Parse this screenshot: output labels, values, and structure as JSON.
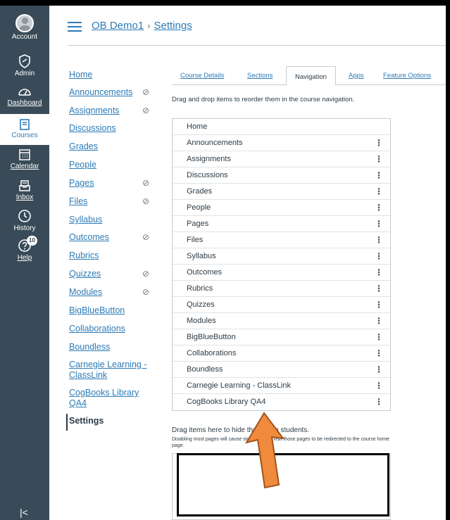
{
  "global_nav": [
    {
      "label": "Account",
      "icon": "avatar"
    },
    {
      "label": "Admin",
      "icon": "shield-icon"
    },
    {
      "label": "Dashboard",
      "icon": "dashboard-icon"
    },
    {
      "label": "Courses",
      "icon": "book-icon"
    },
    {
      "label": "Calendar",
      "icon": "calendar-icon"
    },
    {
      "label": "Inbox",
      "icon": "inbox-icon"
    },
    {
      "label": "History",
      "icon": "clock-icon"
    },
    {
      "label": "Help",
      "icon": "help-icon",
      "badge": "10"
    }
  ],
  "header": {
    "course": "OB Demo1",
    "separator": "›",
    "page": "Settings"
  },
  "course_nav": [
    {
      "label": "Home"
    },
    {
      "label": "Announcements",
      "hidden": true
    },
    {
      "label": "Assignments",
      "hidden": true
    },
    {
      "label": "Discussions"
    },
    {
      "label": "Grades"
    },
    {
      "label": "People"
    },
    {
      "label": "Pages",
      "hidden": true
    },
    {
      "label": "Files",
      "hidden": true
    },
    {
      "label": "Syllabus"
    },
    {
      "label": "Outcomes",
      "hidden": true
    },
    {
      "label": "Rubrics"
    },
    {
      "label": "Quizzes",
      "hidden": true
    },
    {
      "label": "Modules",
      "hidden": true
    },
    {
      "label": "BigBlueButton"
    },
    {
      "label": "Collaborations"
    },
    {
      "label": "Boundless"
    },
    {
      "label": "Carnegie Learning - ClassLink"
    },
    {
      "label": "CogBooks Library QA4"
    },
    {
      "label": "Settings",
      "active": true
    }
  ],
  "tabs": [
    {
      "label": "Course Details"
    },
    {
      "label": "Sections"
    },
    {
      "label": "Navigation",
      "selected": true
    },
    {
      "label": "Apps"
    },
    {
      "label": "Feature Options"
    }
  ],
  "instructions": "Drag and drop items to reorder them in the course navigation.",
  "nav_items": [
    "Home",
    "Announcements",
    "Assignments",
    "Discussions",
    "Grades",
    "People",
    "Pages",
    "Files",
    "Syllabus",
    "Outcomes",
    "Rubrics",
    "Quizzes",
    "Modules",
    "BigBlueButton",
    "Collaborations",
    "Boundless",
    "Carnegie Learning - ClassLink",
    "CogBooks Library QA4"
  ],
  "hidden_section": {
    "title": "Drag items here to hide them from students.",
    "description": "Disabling most pages will cause students who visit those pages to be redirected to the course home page."
  },
  "kebab_glyph": "⋮",
  "eye_glyph": "⊘",
  "colors": {
    "nav_bg": "#394b58",
    "link": "#2d7bb6",
    "arrow": "#f08a3c"
  }
}
